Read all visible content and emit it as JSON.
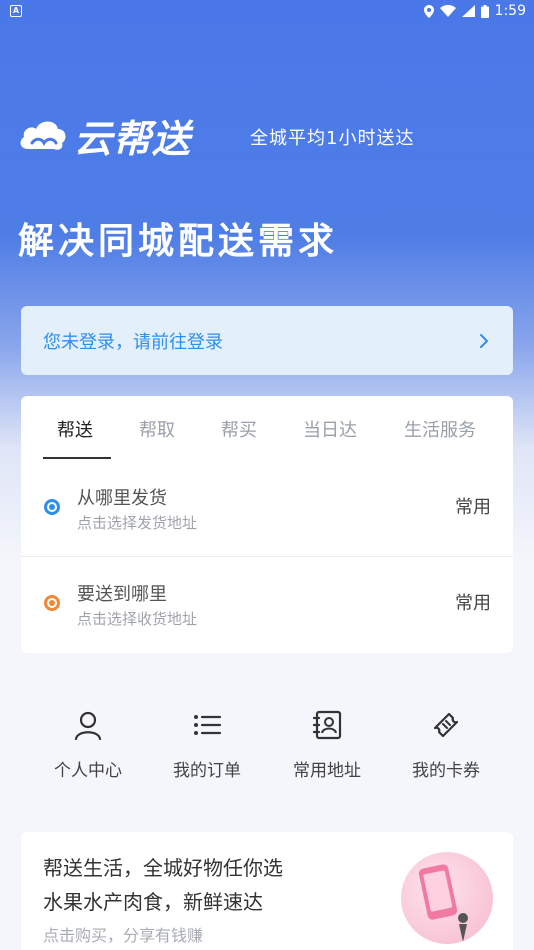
{
  "status_bar": {
    "time": "1:59",
    "notification_icon": "A"
  },
  "header": {
    "brand": "云帮送",
    "slogan": "全城平均1小时送达",
    "headline": "解决同城配送需求"
  },
  "login_banner": {
    "text": "您未登录，请前往登录"
  },
  "tabs": [
    {
      "label": "帮送",
      "active": true
    },
    {
      "label": "帮取",
      "active": false
    },
    {
      "label": "帮买",
      "active": false
    },
    {
      "label": "当日达",
      "active": false
    },
    {
      "label": "生活服务",
      "active": false
    }
  ],
  "sender": {
    "title": "从哪里发货",
    "subtitle": "点击选择发货地址",
    "frequent": "常用",
    "dot_color": "#2f8fe8"
  },
  "receiver": {
    "title": "要送到哪里",
    "subtitle": "点击选择收货地址",
    "frequent": "常用",
    "dot_color": "#f0883a"
  },
  "quick_links": [
    {
      "label": "个人中心",
      "icon": "person-icon"
    },
    {
      "label": "我的订单",
      "icon": "list-icon"
    },
    {
      "label": "常用地址",
      "icon": "address-book-icon"
    },
    {
      "label": "我的卡券",
      "icon": "ticket-icon"
    }
  ],
  "promo": {
    "line1": "帮送生活，全城好物任你选",
    "line2": "水果水产肉食，新鲜速达",
    "line3": "点击购买，分享有钱赚"
  },
  "colors": {
    "primary": "#4a78e8",
    "link": "#2f8fe8",
    "accent_orange": "#f0883a"
  }
}
